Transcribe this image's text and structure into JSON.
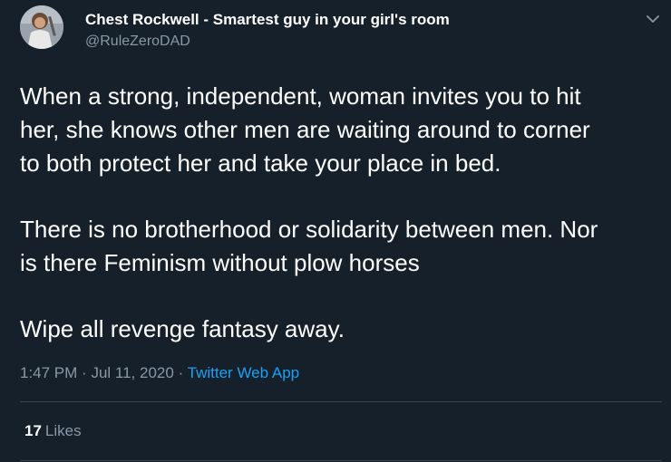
{
  "author": {
    "display_name": "Chest Rockwell - Smartest guy in your girl's room",
    "handle": "@RuleZeroDAD",
    "avatar_icon": "profile-photo"
  },
  "tweet": {
    "lines_p1": [
      "When a strong, independent, woman invites you to hit",
      "her, she knows other men are waiting around to corner",
      "to both protect her and take your place in bed."
    ],
    "lines_p2": [
      "There is no brotherhood or solidarity between men. Nor",
      "is there Feminism without plow horses"
    ],
    "lines_p3": [
      "Wipe all revenge fantasy away."
    ]
  },
  "meta": {
    "time": "1:47 PM",
    "separator": "·",
    "date": "Jul 11, 2020",
    "source": "Twitter Web App"
  },
  "stats": {
    "likes_count": "17",
    "likes_label": "Likes"
  },
  "colors": {
    "background": "#15202b",
    "text": "#ffffff",
    "secondary": "#8899a6",
    "link": "#1da1f2",
    "divider": "#38444d"
  },
  "icons": {
    "more_menu": "chevron-down-icon"
  }
}
